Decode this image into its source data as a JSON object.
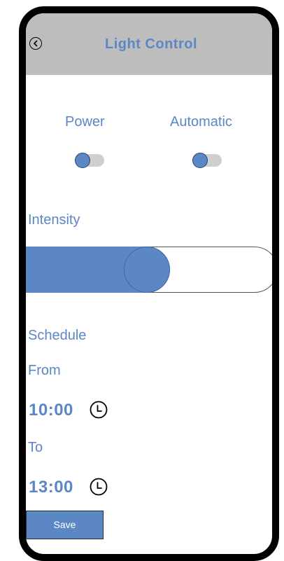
{
  "header": {
    "title": "Light Control"
  },
  "controls": {
    "power_label": "Power",
    "automatic_label": "Automatic",
    "power_on": false,
    "automatic_on": false
  },
  "intensity": {
    "label": "Intensity",
    "value_fraction": 0.54
  },
  "schedule": {
    "label": "Schedule",
    "from_label": "From",
    "from_time": "10:00",
    "to_label": "To",
    "to_time": "13:00"
  },
  "actions": {
    "save_label": "Save"
  },
  "colors": {
    "accent": "#5b87c5",
    "header_bg": "#bdbdbd",
    "toggle_track": "#cfcfcf",
    "frame": "#000000"
  }
}
